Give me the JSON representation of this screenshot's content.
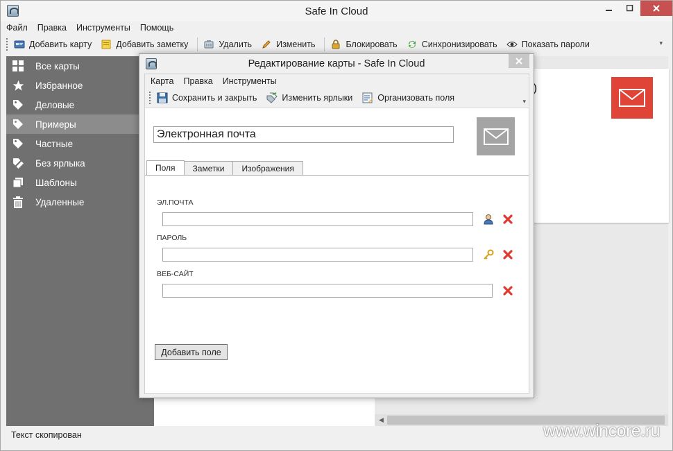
{
  "window": {
    "title": "Safe In Cloud"
  },
  "menu": [
    "Файл",
    "Правка",
    "Инструменты",
    "Помощь"
  ],
  "toolbar": {
    "add_card": "Добавить карту",
    "add_note": "Добавить заметку",
    "delete": "Удалить",
    "edit": "Изменить",
    "lock": "Блокировать",
    "sync": "Синхронизировать",
    "show_passwords": "Показать пароли"
  },
  "sidebar": {
    "items": [
      {
        "label": "Все карты",
        "icon": "grid-icon"
      },
      {
        "label": "Избранное",
        "icon": "star-icon"
      },
      {
        "label": "Деловые",
        "icon": "tag-icon"
      },
      {
        "label": "Примеры",
        "icon": "tag-icon",
        "selected": true
      },
      {
        "label": "Частные",
        "icon": "tag-icon"
      },
      {
        "label": "Без ярлыка",
        "icon": "tag-off-icon"
      },
      {
        "label": "Шаблоны",
        "icon": "templates-icon"
      },
      {
        "label": "Удаленные",
        "icon": "trash-icon"
      }
    ]
  },
  "detail": {
    "partial_text": "р)",
    "badge_color": "#e04436"
  },
  "status": {
    "text": "Текст скопирован"
  },
  "watermark": "www.wincore.ru",
  "dialog": {
    "title": "Редактирование карты - Safe In Cloud",
    "menu": [
      "Карта",
      "Правка",
      "Инструменты"
    ],
    "toolbar": {
      "save_close": "Сохранить и закрыть",
      "change_labels": "Изменить ярлыки",
      "organize_fields": "Организовать поля"
    },
    "card_title": "Электронная почта",
    "tabs": [
      "Поля",
      "Заметки",
      "Изображения"
    ],
    "fields": [
      {
        "label": "ЭЛ.ПОЧТА",
        "value": "",
        "icon": "user-icon"
      },
      {
        "label": "ПАРОЛЬ",
        "value": "",
        "icon": "key-icon"
      },
      {
        "label": "ВЕБ-САЙТ",
        "value": "",
        "icon": ""
      }
    ],
    "add_field": "Добавить поле"
  }
}
